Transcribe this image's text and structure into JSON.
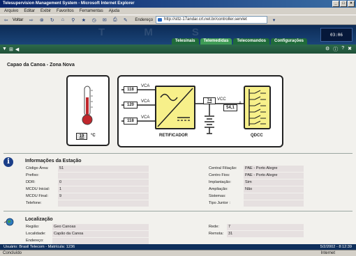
{
  "window": {
    "title": "Telesupervision Management System - Microsoft Internet Explorer",
    "controls": [
      "_",
      "□",
      "×"
    ]
  },
  "menu": [
    "Arquivo",
    "Editar",
    "Exibir",
    "Favoritos",
    "Ferramentas",
    "Ajuda"
  ],
  "toolbar": {
    "back_label": "Voltar",
    "address_label": "Endereço",
    "address_value": "http://sttz-17andar.crt.net.br/controller.servlet"
  },
  "header": {
    "watermark": [
      "T",
      "M",
      "S"
    ],
    "tabs": [
      "Telesinais",
      "Telemedidas",
      "Telecomandos",
      "Configurações"
    ],
    "active_tab": "Telemedidas",
    "clock": "03:06"
  },
  "site": {
    "title": "Capao da Canoa - Zona Nova"
  },
  "diagram": {
    "temperature": "19",
    "temperature_unit": "°C",
    "vca_values": [
      "118",
      "120",
      "118"
    ],
    "vca_label": "VCA",
    "vcc_voltage": "74",
    "vcc_label": "VCC",
    "current": "54,1",
    "current_unit": "A",
    "rectifier_label": "RETIFICADOR",
    "qdcc_label": "QDCC"
  },
  "station_info": {
    "title": "Informações da Estação",
    "left": [
      {
        "label": "Código Área:",
        "value": "51"
      },
      {
        "label": "Prefixo:",
        "value": ""
      },
      {
        "label": "DDR:",
        "value": "0"
      },
      {
        "label": "MCDU Inicial:",
        "value": "1"
      },
      {
        "label": "MCDU Final:",
        "value": "9"
      },
      {
        "label": "Telefone:",
        "value": ""
      }
    ],
    "right": [
      {
        "label": "Central Filiação:",
        "value": "PAE - Porto Alegre"
      },
      {
        "label": "Centro Fios:",
        "value": "PAE - Porto Alegre"
      },
      {
        "label": "Implantação:",
        "value": "Sim"
      },
      {
        "label": "Ampliação:",
        "value": "Não"
      },
      {
        "label": "Sistemas:",
        "value": ""
      },
      {
        "label": "Tipo Juntor :",
        "value": ""
      }
    ]
  },
  "location": {
    "title": "Localização",
    "left": [
      {
        "label": "Região:",
        "value": "Geo Canoas"
      },
      {
        "label": "Localidade:",
        "value": "Capão da Canoa"
      },
      {
        "label": "Endereço:",
        "value": ""
      }
    ],
    "right": [
      {
        "label": "Rede:",
        "value": "7"
      },
      {
        "label": "Remota:",
        "value": "31"
      }
    ]
  },
  "app_status": {
    "user": "Usuário: Brasil Telecom - Matrícula: 1236",
    "datetime": "5/2/2002 - 8:12:39"
  },
  "browser_status": {
    "left": "Concluído",
    "zone": "Internet"
  }
}
